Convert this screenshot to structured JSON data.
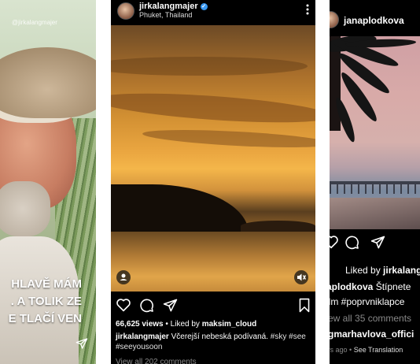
{
  "left_story": {
    "watermark": "@jirkalangmajer",
    "caption_lines": [
      "HLAVĚ MÁM",
      ". A TOLIK ZE",
      "E TLAČÍ VEN"
    ]
  },
  "middle_post": {
    "username": "jirkalangmajer",
    "location": "Phuket, Thailand",
    "views_text": "66,625 views",
    "liked_by_prefix": "Liked by",
    "liked_by_user": "maksim_cloud",
    "caption_user": "jirkalangmajer",
    "caption_text": "Včerejší nebeská podívaná.",
    "tags": [
      "#sky",
      "#see",
      "#seeyousoon"
    ],
    "view_all": "View all 202 comments"
  },
  "right_post": {
    "username": "janaplodkova",
    "liked_by_prefix": "Liked by",
    "liked_by_user": "jirkalang",
    "caption_user": "aplodkova",
    "caption_text": "Štípnete",
    "hashtags": "llm #poprvniklapce",
    "view_all": "ew all 35 comments",
    "comment_user": "gmarhavlova_offici",
    "time": "ys ago",
    "see_translation": "See Translation"
  },
  "colors": {
    "background": "#000000",
    "text": "#ffffff",
    "muted": "#888888",
    "verified": "#3897f0"
  },
  "icons": [
    "heart-icon",
    "comment-icon",
    "share-icon",
    "bookmark-icon",
    "more-icon",
    "verified-icon",
    "tag-people-icon",
    "muted-icon",
    "send-icon"
  ]
}
